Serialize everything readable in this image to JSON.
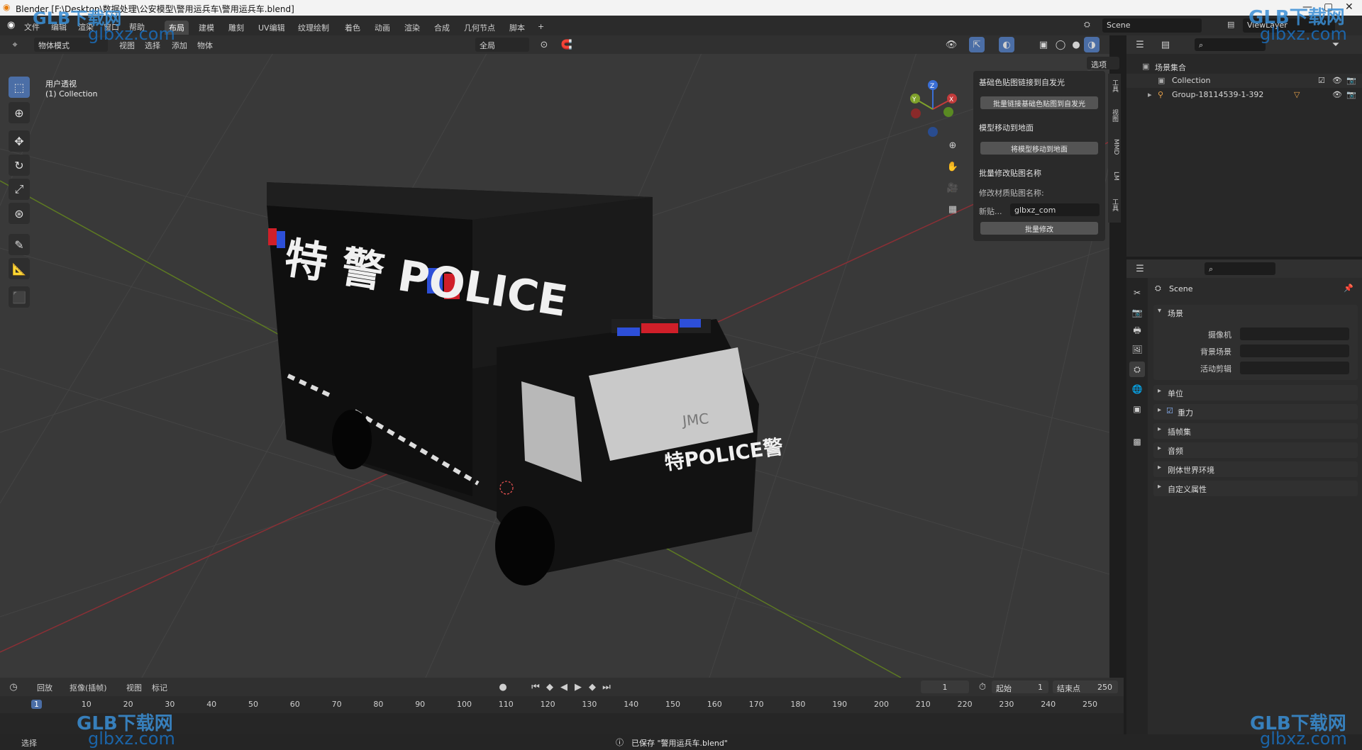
{
  "window": {
    "title": "Blender [F:\\Desktop\\数据处理\\公安模型\\警用运兵车\\警用运兵车.blend]"
  },
  "menu": [
    "文件",
    "编辑",
    "渲染",
    "窗口",
    "帮助"
  ],
  "workspaces": [
    "布局",
    "建模",
    "雕刻",
    "UV编辑",
    "纹理绘制",
    "着色",
    "动画",
    "渲染",
    "合成",
    "几何节点",
    "脚本"
  ],
  "active_workspace": "布局",
  "scene_field": "Scene",
  "viewlayer_field": "ViewLayer",
  "viewport": {
    "mode": "物体模式",
    "menus": [
      "视图",
      "选择",
      "添加",
      "物体"
    ],
    "orientation": "全局",
    "options": "选项",
    "overlay_title": "用户透视",
    "overlay_collection": "(1) Collection",
    "gizmo_axes": {
      "x": "X",
      "y": "Y",
      "z": "Z"
    }
  },
  "npanel": {
    "section1": "基础色贴图链接到自发光",
    "btn1": "批量链接基础色贴图到自发光",
    "section2": "模型移动到地面",
    "btn2": "将模型移动到地面",
    "section3": "批量修改贴图名称",
    "label": "修改材质贴图名称:",
    "new_label": "新贴...",
    "new_value": "glbxz_com",
    "btn3": "批量修改",
    "tabs": [
      "工具",
      "视图",
      "MMD",
      "LM",
      "工具"
    ]
  },
  "outliner": {
    "root": "场景集合",
    "collection": "Collection",
    "object": "Group-18114539-1-392"
  },
  "properties": {
    "title": "Scene",
    "scene_section": "场景",
    "camera_label": "摄像机",
    "bg_label": "背景场景",
    "clip_label": "活动剪辑",
    "sections": [
      "单位",
      "重力",
      "插帧集",
      "音频",
      "刚体世界环境",
      "自定义属性"
    ],
    "gravity_checked": true
  },
  "timeline": {
    "menus": [
      "回放",
      "抠像(插帧)",
      "视图",
      "标记"
    ],
    "current_frame": "1",
    "start_label": "起始",
    "start": "1",
    "end_label": "结束点",
    "end": "250",
    "ticks": [
      "1",
      "10",
      "20",
      "30",
      "40",
      "50",
      "60",
      "70",
      "80",
      "90",
      "100",
      "110",
      "120",
      "130",
      "140",
      "150",
      "160",
      "170",
      "180",
      "190",
      "200",
      "210",
      "220",
      "230",
      "240",
      "250"
    ]
  },
  "status": {
    "left": "选择",
    "message": "已保存 \"警用运兵车.blend\""
  },
  "truck_text": {
    "side": "特 警 POLICE",
    "front": "特POLICE警",
    "brand": "JMC"
  },
  "watermark": {
    "brand": "GLB下载网",
    "url": "glbxz.com"
  },
  "colors": {
    "accent": "#4b6ea6",
    "viewport_bg": "#393939",
    "x_axis": "#c23b3b",
    "y_axis": "#7fa12b",
    "z_axis": "#3a6fd6"
  }
}
